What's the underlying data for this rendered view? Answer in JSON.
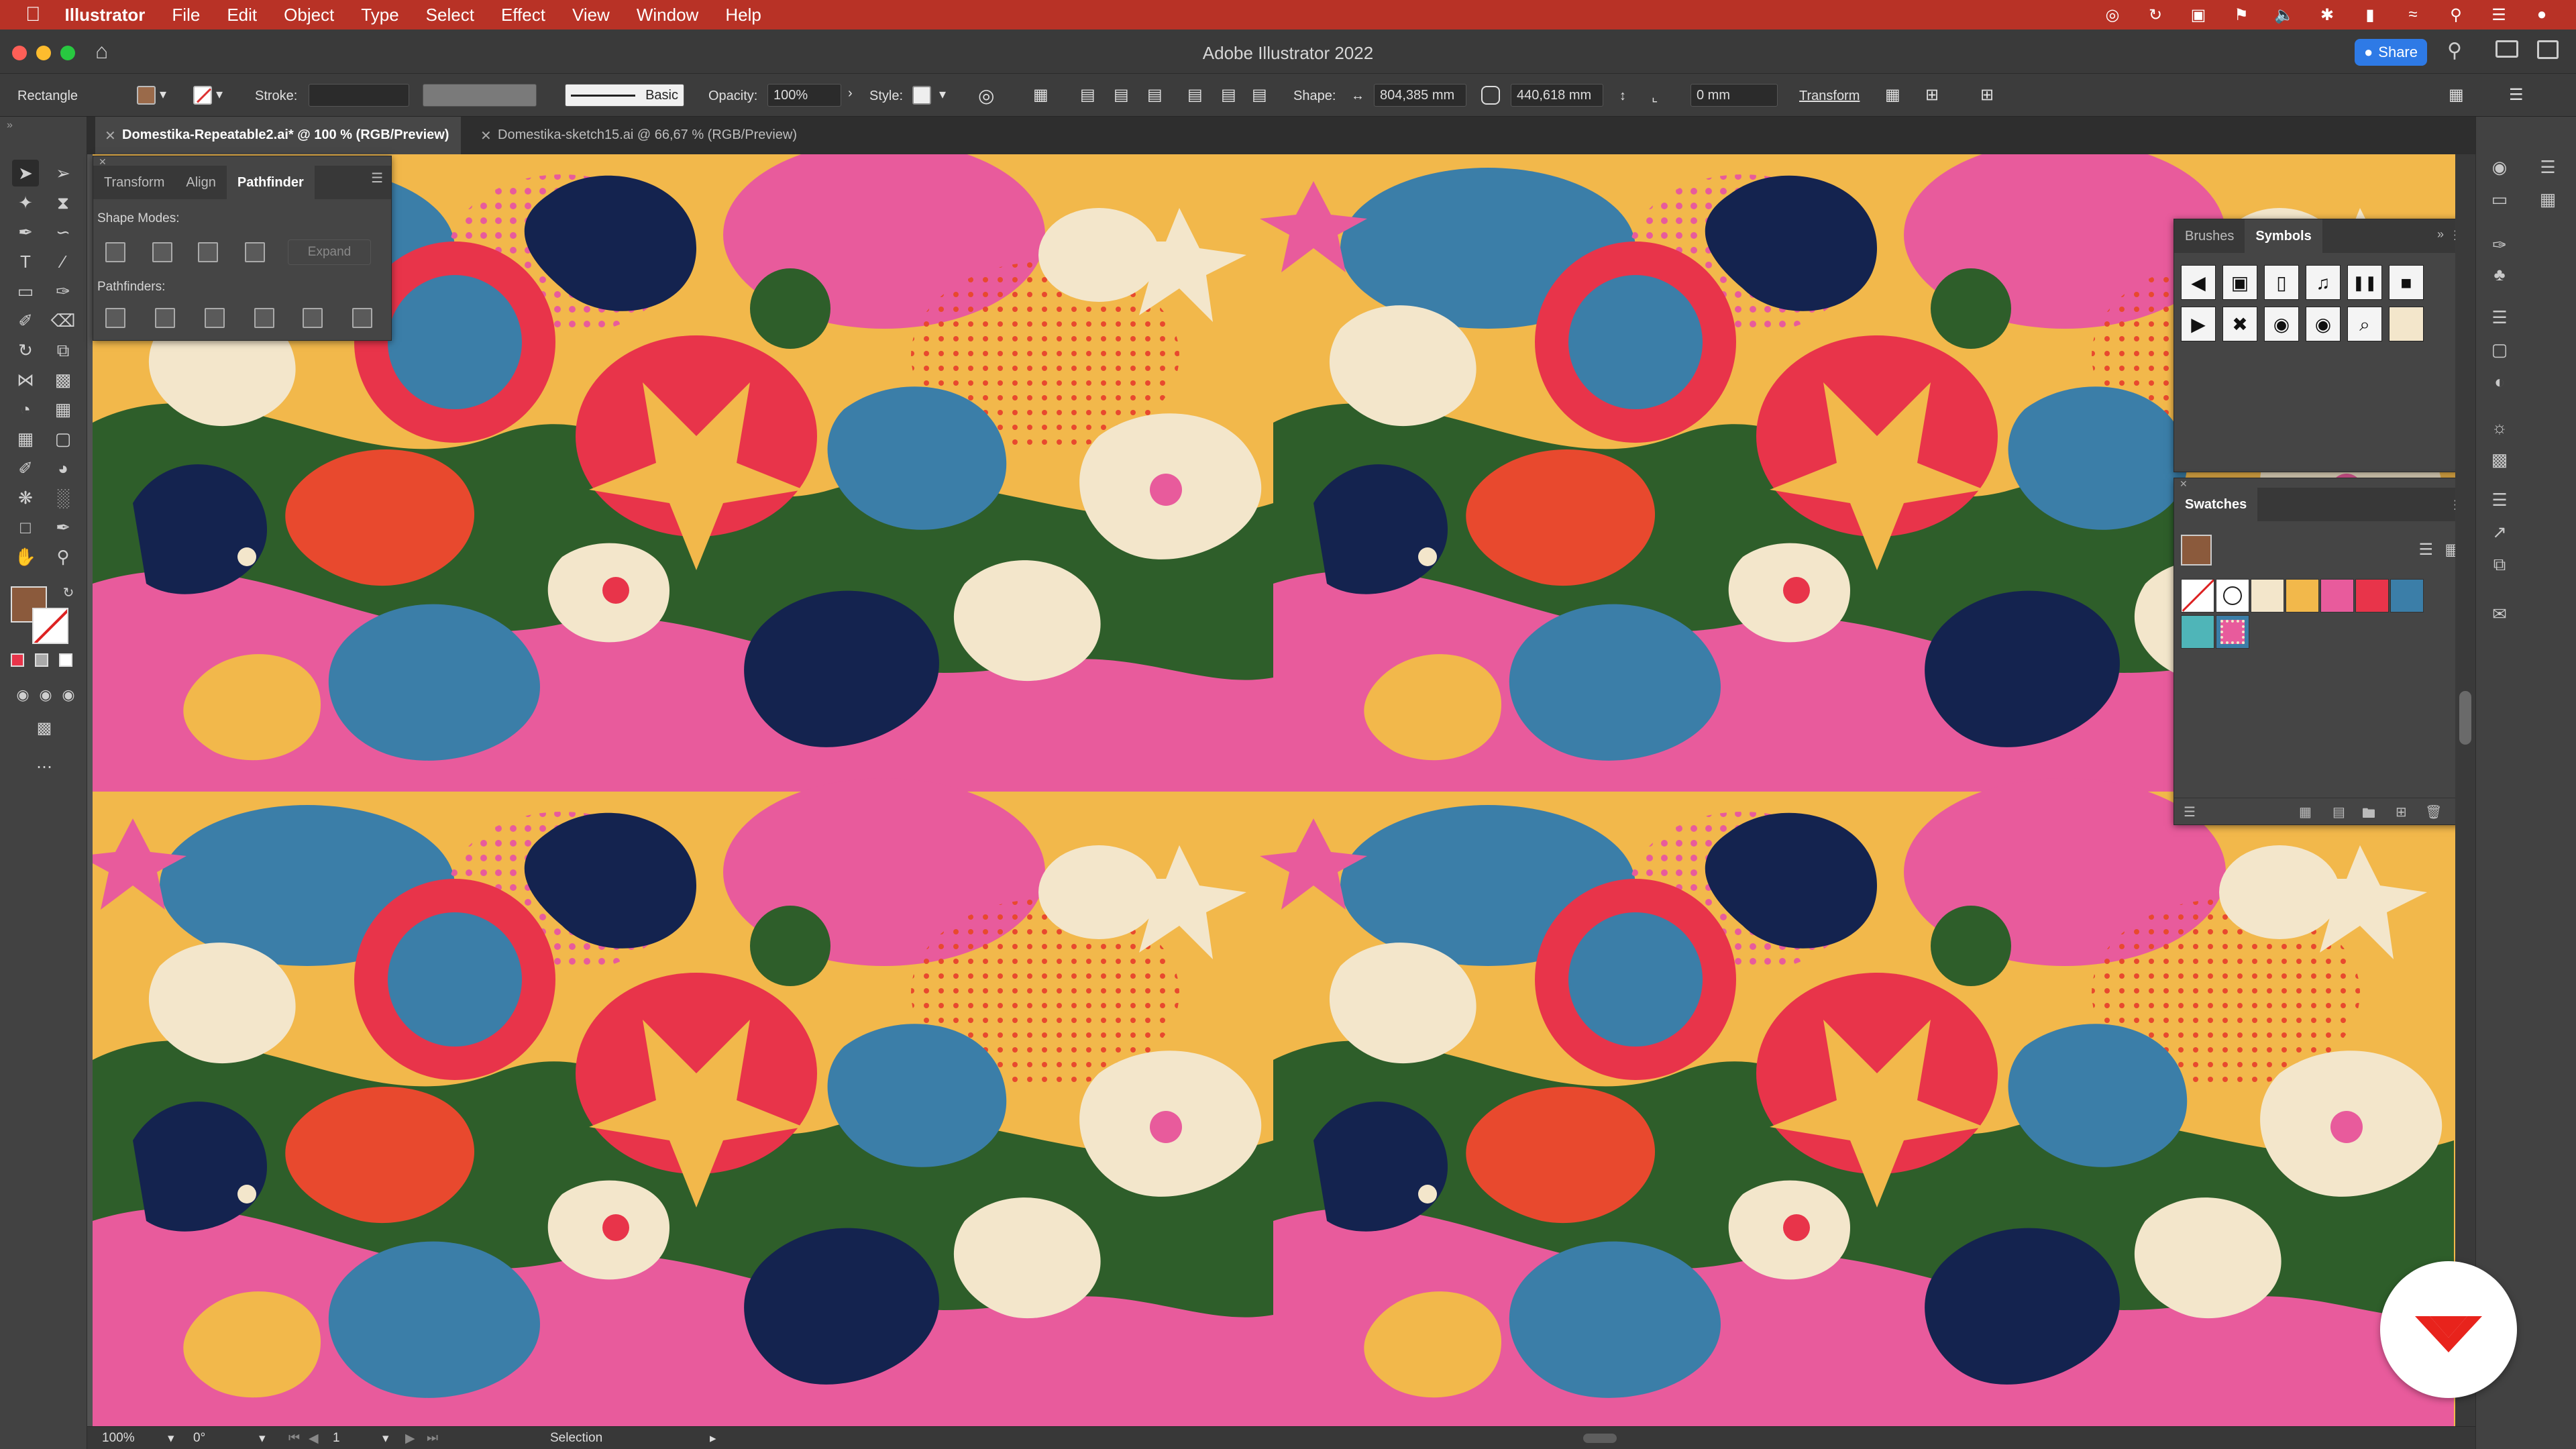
{
  "menubar": {
    "apple": "",
    "app": "Illustrator",
    "items": [
      "File",
      "Edit",
      "Object",
      "Type",
      "Select",
      "Effect",
      "View",
      "Window",
      "Help"
    ]
  },
  "window": {
    "title": "Adobe Illustrator 2022",
    "share_label": "Share"
  },
  "control_bar": {
    "object_type": "Rectangle",
    "stroke_label": "Stroke:",
    "brush_label": "Basic",
    "opacity_label": "Opacity:",
    "opacity_value": "100%",
    "style_label": "Style:",
    "shape_label": "Shape:",
    "width_value": "804,385 mm",
    "height_value": "440,618 mm",
    "corner_value": "0 mm",
    "transform_label": "Transform"
  },
  "tabs": [
    {
      "label": "Domestika-Repeatable2.ai* @ 100 % (RGB/Preview)",
      "active": true
    },
    {
      "label": "Domestika-sketch15.ai @ 66,67 % (RGB/Preview)",
      "active": false
    }
  ],
  "pathfinder_panel": {
    "tabs": [
      "Transform",
      "Align",
      "Pathfinder"
    ],
    "shape_modes_label": "Shape Modes:",
    "expand_label": "Expand",
    "pathfinders_label": "Pathfinders:"
  },
  "symbols_panel": {
    "tabs": [
      "Brushes",
      "Symbols"
    ],
    "symbols_row1": [
      "◀",
      "▣",
      "▯",
      "♫",
      "❚❚",
      "■"
    ],
    "symbols_row2": [
      "▶",
      "✖",
      "◉",
      "◉",
      "⌕",
      ""
    ]
  },
  "swatches_panel": {
    "title": "Swatches",
    "colors": [
      "#f3e6cb",
      "#f2b84b",
      "#e85b9c",
      "#e8344a",
      "#3b7ea8",
      "#4fb5b8"
    ]
  },
  "status_bar": {
    "zoom": "100%",
    "rotation": "0°",
    "artboard": "1",
    "tool": "Selection"
  },
  "colors": {
    "menubar": "#b83226",
    "canvas_yellow": "#f2b84b",
    "pink": "#e85b9c",
    "red": "#e8344a",
    "blue": "#3b7ea8",
    "navy": "#14234f",
    "green": "#2e5e2a",
    "cream": "#f3e6cb",
    "orange": "#e8492e"
  }
}
